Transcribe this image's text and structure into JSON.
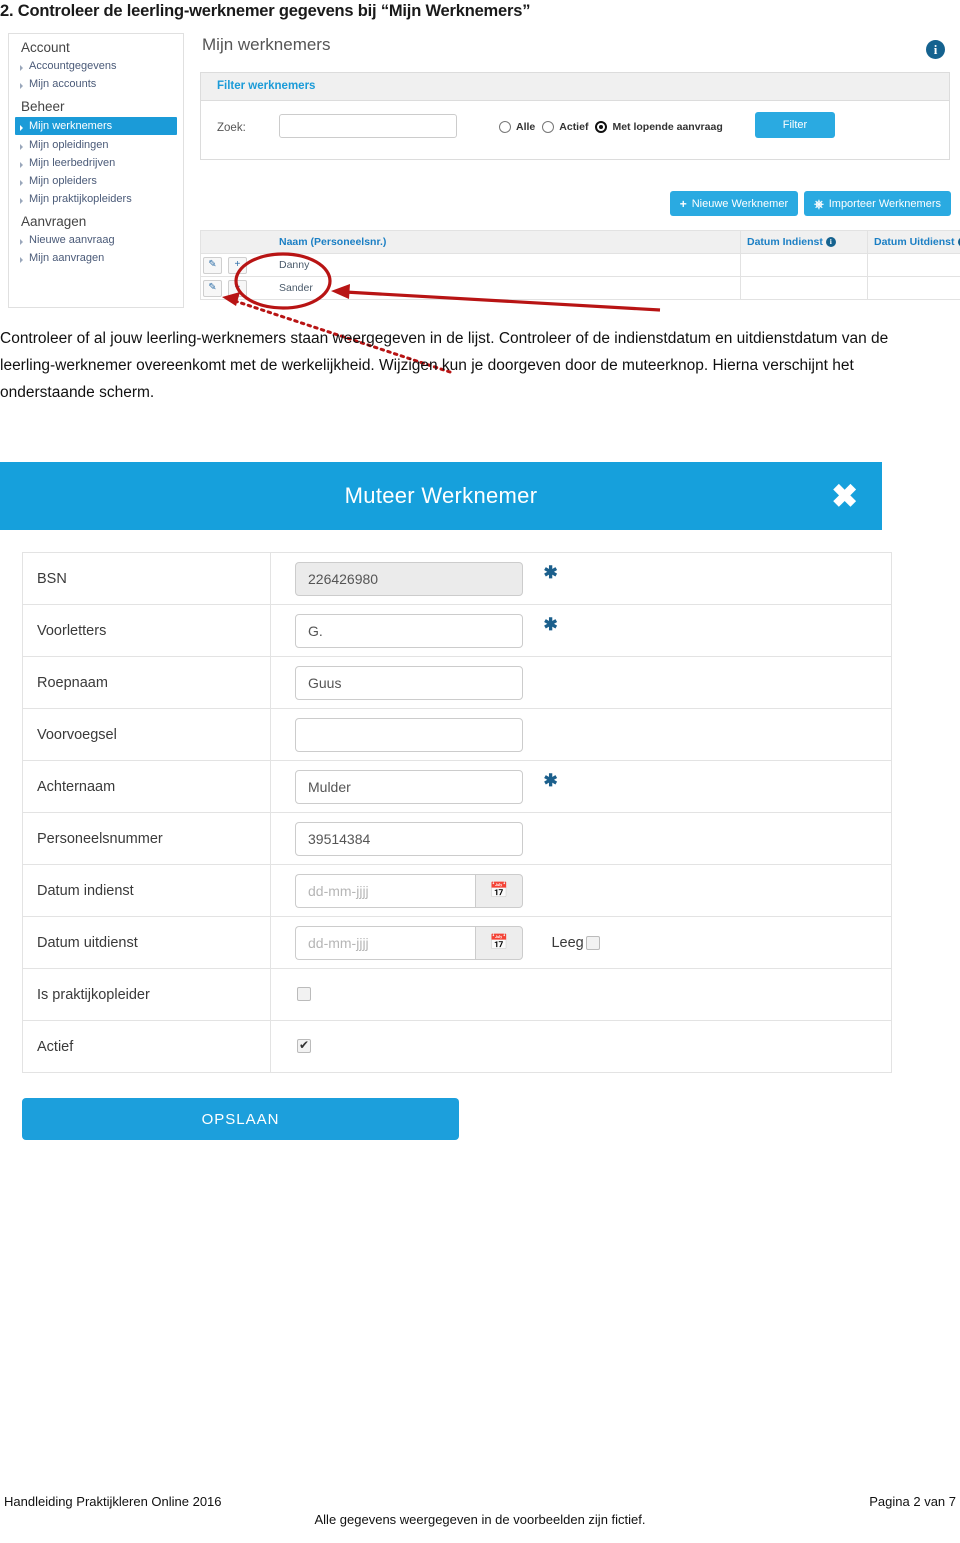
{
  "heading": "2. Controleer de leerling-werknemer gegevens bij “Mijn Werknemers”",
  "screenshot_one": {
    "sidebar": {
      "groups": [
        {
          "title": "Account",
          "items": [
            {
              "label": "Accountgegevens",
              "active": false
            },
            {
              "label": "Mijn accounts",
              "active": false
            }
          ]
        },
        {
          "title": "Beheer",
          "items": [
            {
              "label": "Mijn werknemers",
              "active": true
            },
            {
              "label": "Mijn opleidingen",
              "active": false
            },
            {
              "label": "Mijn leerbedrijven",
              "active": false
            },
            {
              "label": "Mijn opleiders",
              "active": false
            },
            {
              "label": "Mijn praktijkopleiders",
              "active": false
            }
          ]
        },
        {
          "title": "Aanvragen",
          "items": [
            {
              "label": "Nieuwe aanvraag",
              "active": false
            },
            {
              "label": "Mijn aanvragen",
              "active": false
            }
          ]
        }
      ]
    },
    "page_title": "Mijn werknemers",
    "info_icon": "info-icon",
    "filter": {
      "panel_title": "Filter werknemers",
      "search_label": "Zoek:",
      "search_value": "",
      "search_placeholder": "",
      "radios": [
        {
          "label": "Alle",
          "selected": false
        },
        {
          "label": "Actief",
          "selected": false
        },
        {
          "label": "Met lopende aanvraag",
          "selected": true
        }
      ],
      "filter_button": "Filter"
    },
    "actions": {
      "new_employee": "Nieuwe Werknemer",
      "new_employee_icon": "plus-icon",
      "import_employees": "Importeer Werknemers",
      "import_icon": "import-icon"
    },
    "table": {
      "columns": [
        "",
        "Naam (Personeelsnr.)",
        "Datum Indienst",
        "Datum Uitdienst"
      ],
      "rows": [
        {
          "edit_icon": "pencil-icon",
          "add_icon": "plus-icon",
          "name": "Danny",
          "datum_indienst": "",
          "datum_uitdienst": ""
        },
        {
          "edit_icon": "pencil-icon",
          "add_icon": "plus-icon",
          "name": "Sander",
          "datum_indienst": "",
          "datum_uitdienst": ""
        }
      ]
    }
  },
  "body_text": "Controleer of al jouw leerling-werknemers staan weergegeven in de lijst. Controleer of de indienstdatum en uitdienstdatum van de leerling-werknemer overeenkomt met de werkelijkheid. Wijzigen kun je doorgeven door de muteerknop. Hierna verschijnt het onderstaande scherm.",
  "screenshot_two": {
    "modal_title": "Muteer Werknemer",
    "close_icon": "close-icon",
    "fields": [
      {
        "label": "BSN",
        "value": "226426980",
        "placeholder": "",
        "required": true,
        "type": "text",
        "readonly": true
      },
      {
        "label": "Voorletters",
        "value": "G.",
        "placeholder": "",
        "required": true,
        "type": "text",
        "readonly": false
      },
      {
        "label": "Roepnaam",
        "value": "Guus",
        "placeholder": "",
        "required": false,
        "type": "text",
        "readonly": false
      },
      {
        "label": "Voorvoegsel",
        "value": "",
        "placeholder": "",
        "required": false,
        "type": "text",
        "readonly": false
      },
      {
        "label": "Achternaam",
        "value": "Mulder",
        "placeholder": "",
        "required": true,
        "type": "text",
        "readonly": false
      },
      {
        "label": "Personeelsnummer",
        "value": "39514384",
        "placeholder": "",
        "required": false,
        "type": "text",
        "readonly": false
      },
      {
        "label": "Datum indienst",
        "value": "",
        "placeholder": "dd-mm-jjjj",
        "required": false,
        "type": "date",
        "readonly": false
      },
      {
        "label": "Datum uitdienst",
        "value": "",
        "placeholder": "dd-mm-jjjj",
        "required": false,
        "type": "date",
        "readonly": false,
        "extra_label": "Leeg",
        "extra_checked": false
      },
      {
        "label": "Is praktijkopleider",
        "value": "",
        "placeholder": "",
        "required": false,
        "type": "checkbox",
        "checked": false
      },
      {
        "label": "Actief",
        "value": "",
        "placeholder": "",
        "required": false,
        "type": "checkbox",
        "checked": true
      }
    ],
    "calendar_icon": "calendar-icon",
    "save_button": "OPSLAAN"
  },
  "footer": {
    "left": "Handleiding Praktijkleren Online 2016",
    "right": "Pagina 2 van 7",
    "center": "Alle gegevens weergegeven in de voorbeelden zijn fictief."
  },
  "colors": {
    "accent_blue": "#2aaae1",
    "modal_blue": "#16a0dc",
    "link_blue": "#1b7fc4",
    "annotation_red": "#b81414",
    "info_navy": "#15628f"
  }
}
